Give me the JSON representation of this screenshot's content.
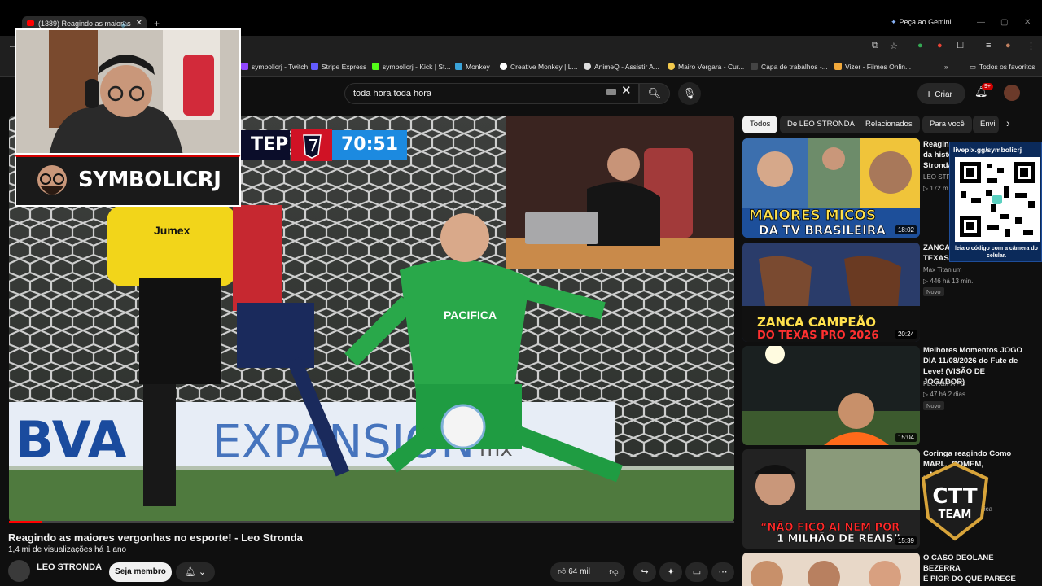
{
  "browser": {
    "tab_title": "(1389) Reagindo as maiores",
    "gemini_label": "Peça ao Gemini",
    "bookmarks": [
      {
        "label": "symbolicrj - Twitch",
        "color": "#9146ff"
      },
      {
        "label": "Stripe Express",
        "color": "#635bff"
      },
      {
        "label": "symbolicrj - Kick | St...",
        "color": "#53fc18"
      },
      {
        "label": "Monkey",
        "color": "#3aa3d9"
      },
      {
        "label": "Creative Monkey | L...",
        "color": "#ffffff"
      },
      {
        "label": "AnimeQ - Assistir A...",
        "color": "#dddddd"
      },
      {
        "label": "Mairo Vergara - Cur...",
        "color": "#f2c94c"
      },
      {
        "label": "Capa de trabalhos -...",
        "color": "#444444"
      },
      {
        "label": "Vizer - Filmes Onlin...",
        "color": "#f2a93b"
      }
    ],
    "all_favorites": "Todos os favoritos"
  },
  "header": {
    "search_value": "toda hora toda hora",
    "create_label": "Criar",
    "notif_badge": "9+"
  },
  "video": {
    "score_team": "TEP",
    "score_clock": "70:51",
    "progress": 0.045,
    "ad_board_1": "BVA",
    "ad_board_2": "EXPANSIÓN",
    "ad_board_3": "mx",
    "keeper_sponsor": "PACIFICA",
    "referee_logo": "Jumex",
    "streamer_logo": "SYMBOLICRJ"
  },
  "info": {
    "title": "Reagindo as maiores vergonhas no esporte! - Leo Stronda",
    "meta": "1,4 mi de visualizações  há 1 ano",
    "channel": "LEO STRONDA",
    "join": "Seja membro",
    "likes": "64 mil"
  },
  "chips": [
    "Todos",
    "De LEO STRONDA",
    "Relacionados",
    "Para você",
    "Envi"
  ],
  "related": [
    {
      "title": "Reagindo aos maiores micos da história - Leo Stronda",
      "title_shown_1": "Reagin",
      "title_shown_2": "da histo",
      "title_shown_3": "Stronda",
      "channel": "LEO STR",
      "stats": "▷ 172 m",
      "duration": "18:02",
      "thumb_text_1": "MAIORES MICOS",
      "thumb_text_2": "DA TV BRASILEIRA"
    },
    {
      "title_1": "ZANCA",
      "title_2": "TEXAS",
      "channel": "Max Titanium",
      "stats": "▷ 446  há 13 min.",
      "badge": "Novo",
      "duration": "20:24",
      "thumb_text_1": "ZANCA CAMPEÃO",
      "thumb_text_2": "DO TEXAS PRO 2026"
    },
    {
      "title_1": "Melhores Momentos JOGO",
      "title_2": "DIA 11/08/2026 do Fute de",
      "title_3": "Leve! (VISÃO DE JOGADOR)",
      "channel": "FLOR&IPA FC",
      "stats": "▷ 47  há 2 dias",
      "badge": "Novo",
      "duration": "15:04"
    },
    {
      "title_1": "Coringa reagindo Como",
      "title_2": "MARI...     COMEM,",
      "title_3": "...M BANH...",
      "stats": "...tica",
      "duration": "15:39",
      "thumb_text_1": "“NÃO FICO AI NEM POR",
      "thumb_text_2": "1 MILHÃO DE REAIS”"
    },
    {
      "title_1": "O CASO DEOLANE BEZERRA",
      "title_2": "É PIOR DO QUE PARECE"
    }
  ],
  "overlay_qr": {
    "url": "livepix.gg/symbolicrj",
    "caption": "leia o código com a câmera do celular."
  },
  "overlay_team": {
    "line1": "CTT",
    "line2": "TEAM"
  }
}
